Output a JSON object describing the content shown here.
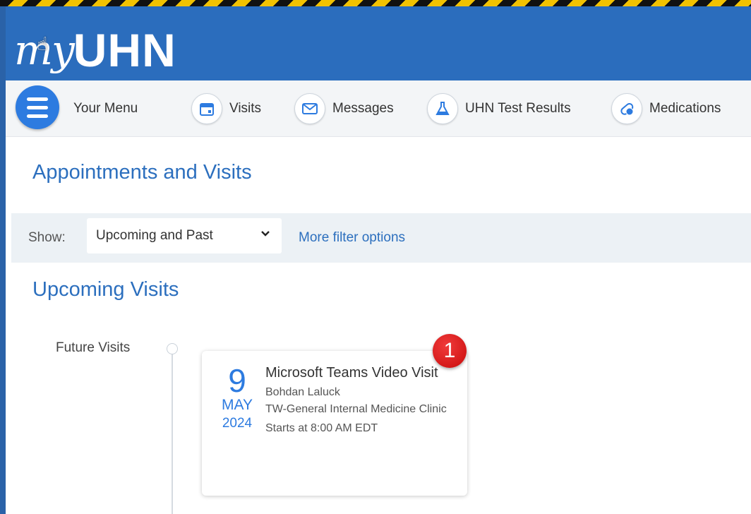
{
  "app": {
    "logo_my": "my",
    "logo_uhn": "UHN"
  },
  "nav": {
    "menu_label": "Your Menu",
    "items": [
      {
        "label": "Visits",
        "icon": "calendar-icon"
      },
      {
        "label": "Messages",
        "icon": "envelope-icon"
      },
      {
        "label": "UHN Test Results",
        "icon": "flask-icon"
      },
      {
        "label": "Medications",
        "icon": "pill-icon"
      }
    ]
  },
  "page": {
    "title": "Appointments and Visits"
  },
  "filter": {
    "show_label": "Show:",
    "selected": "Upcoming and Past",
    "more_link": "More filter options"
  },
  "upcoming": {
    "title": "Upcoming Visits",
    "group_label": "Future Visits",
    "visit": {
      "day": "9",
      "month": "MAY",
      "year": "2024",
      "title": "Microsoft Teams Video Visit",
      "provider": "Bohdan Laluck",
      "department": "TW-General Internal Medicine Clinic",
      "time": "Starts at 8:00 AM EDT"
    }
  },
  "callout": {
    "number": "1"
  },
  "colors": {
    "brand_blue": "#2b6dbd",
    "link_blue": "#2c6fbe",
    "accent_blue": "#2d7be0",
    "badge_red": "#d81414"
  }
}
